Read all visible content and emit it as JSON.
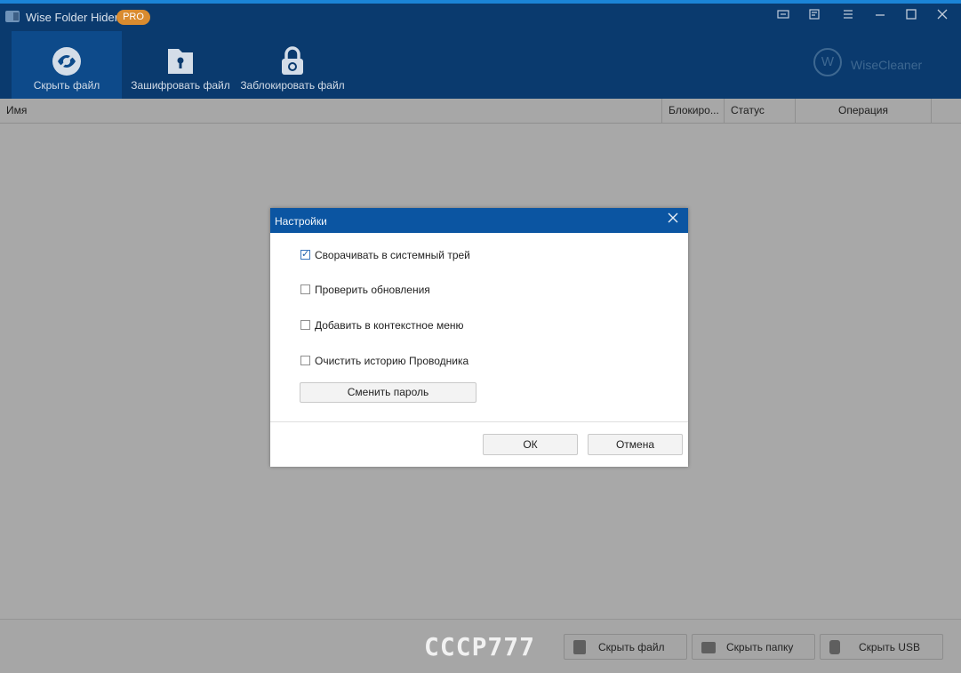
{
  "app": {
    "title": "Wise Folder Hider",
    "badge": "PRO",
    "brand": "WiseCleaner",
    "brand_mark": "W"
  },
  "window_controls": [
    "feedback-icon",
    "notes-icon",
    "menu-icon",
    "minimize-icon",
    "maximize-icon",
    "close-icon"
  ],
  "toolbar": {
    "items": [
      {
        "label": "Скрыть файл",
        "icon": "eye-slash-icon",
        "active": true
      },
      {
        "label": "Зашифровать файл",
        "icon": "encrypted-folder-icon",
        "active": false
      },
      {
        "label": "Заблокировать файл",
        "icon": "padlock-icon",
        "active": false
      }
    ]
  },
  "table": {
    "columns": [
      "Имя",
      "Блокиро...",
      "Статус",
      "Операция"
    ]
  },
  "footer": {
    "watermark": "CCCP777",
    "buttons": [
      {
        "label": "Скрыть файл",
        "icon": "file-icon"
      },
      {
        "label": "Скрыть папку",
        "icon": "folder-icon"
      },
      {
        "label": "Скрыть USB",
        "icon": "usb-icon"
      }
    ]
  },
  "dialog": {
    "title": "Настройки",
    "options": [
      {
        "label": "Сворачивать в системный трей",
        "checked": true
      },
      {
        "label": "Проверить обновления",
        "checked": false
      },
      {
        "label": "Добавить в контекстное меню",
        "checked": false
      },
      {
        "label": "Очистить историю Проводника",
        "checked": false
      }
    ],
    "change_password": "Сменить пароль",
    "ok": "ОК",
    "cancel": "Отмена"
  },
  "colors": {
    "header": "#0a3a6e",
    "dialog_title": "#0b55a2",
    "badge": "#d98b2f",
    "overlay": "#a8a8a8"
  }
}
